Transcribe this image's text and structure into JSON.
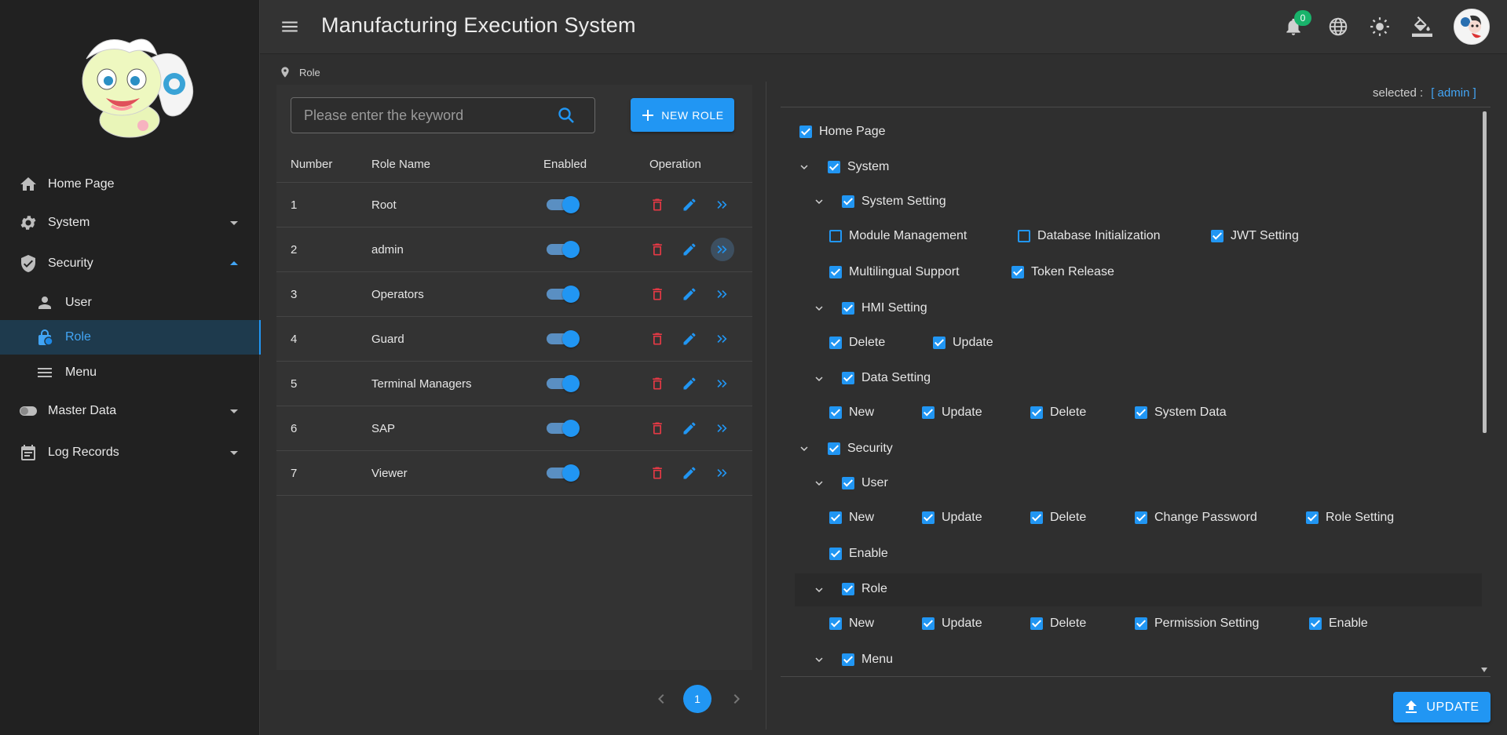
{
  "app": {
    "title": "Manufacturing Execution System"
  },
  "colors": {
    "accent": "#2196f3",
    "danger": "#e53945",
    "badge": "#19b36b",
    "sidebar_bg": "#212121",
    "panel_bg": "#333333"
  },
  "header": {
    "icons": [
      "menu-icon",
      "bell-icon",
      "globe-icon",
      "sun-icon",
      "paint-bucket-icon"
    ],
    "notification_count": "0"
  },
  "sidebar": {
    "items": [
      {
        "label": "Home Page",
        "icon": "home-icon"
      },
      {
        "label": "System",
        "icon": "gear-icon"
      },
      {
        "label": "Security",
        "icon": "shield-icon"
      },
      {
        "label": "User",
        "icon": "person-icon"
      },
      {
        "label": "Role",
        "icon": "lock-icon"
      },
      {
        "label": "Menu",
        "icon": "list-icon"
      },
      {
        "label": "Master Data",
        "icon": "toggle-icon"
      },
      {
        "label": "Log Records",
        "icon": "calendar-icon"
      }
    ],
    "active": "Role"
  },
  "breadcrumb": {
    "current": "Role"
  },
  "roles": {
    "search_placeholder": "Please enter the keyword",
    "new_button": "NEW ROLE",
    "columns": [
      "Number",
      "Role Name",
      "Enabled",
      "Operation"
    ],
    "rows": [
      {
        "number": "1",
        "name": "Root",
        "enabled": true
      },
      {
        "number": "2",
        "name": "admin",
        "enabled": true
      },
      {
        "number": "3",
        "name": "Operators",
        "enabled": true
      },
      {
        "number": "4",
        "name": "Guard",
        "enabled": true
      },
      {
        "number": "5",
        "name": "Terminal Managers",
        "enabled": true
      },
      {
        "number": "6",
        "name": "SAP",
        "enabled": true
      },
      {
        "number": "7",
        "name": "Viewer",
        "enabled": true
      }
    ]
  },
  "pagination": {
    "current_page": "1"
  },
  "permissions": {
    "selected_label": "selected :",
    "selected_value": "[ admin ]",
    "tree": {
      "home": {
        "label": "Home Page",
        "checked": true
      },
      "system": {
        "label": "System",
        "checked": true
      },
      "system_setting": {
        "label": "System Setting",
        "checked": true
      },
      "module_management": {
        "label": "Module Management",
        "checked": false
      },
      "database_initialization": {
        "label": "Database Initialization",
        "checked": false
      },
      "jwt_setting": {
        "label": "JWT Setting",
        "checked": true
      },
      "multilingual_support": {
        "label": "Multilingual Support",
        "checked": true
      },
      "token_release": {
        "label": "Token Release",
        "checked": true
      },
      "hmi_setting": {
        "label": "HMI Setting",
        "checked": true
      },
      "hmi_delete": {
        "label": "Delete",
        "checked": true
      },
      "hmi_update": {
        "label": "Update",
        "checked": true
      },
      "data_setting": {
        "label": "Data Setting",
        "checked": true
      },
      "data_new": {
        "label": "New",
        "checked": true
      },
      "data_update": {
        "label": "Update",
        "checked": true
      },
      "data_delete": {
        "label": "Delete",
        "checked": true
      },
      "data_system_data": {
        "label": "System Data",
        "checked": true
      },
      "security": {
        "label": "Security",
        "checked": true
      },
      "user": {
        "label": "User",
        "checked": true
      },
      "user_new": {
        "label": "New",
        "checked": true
      },
      "user_update": {
        "label": "Update",
        "checked": true
      },
      "user_delete": {
        "label": "Delete",
        "checked": true
      },
      "user_change_password": {
        "label": "Change Password",
        "checked": true
      },
      "user_role_setting": {
        "label": "Role Setting",
        "checked": true
      },
      "user_enable": {
        "label": "Enable",
        "checked": true
      },
      "role": {
        "label": "Role",
        "checked": true
      },
      "role_new": {
        "label": "New",
        "checked": true
      },
      "role_update": {
        "label": "Update",
        "checked": true
      },
      "role_delete": {
        "label": "Delete",
        "checked": true
      },
      "role_permission_setting": {
        "label": "Permission Setting",
        "checked": true
      },
      "role_enable": {
        "label": "Enable",
        "checked": true
      },
      "menu": {
        "label": "Menu",
        "checked": true
      }
    },
    "update_button": "UPDATE"
  }
}
